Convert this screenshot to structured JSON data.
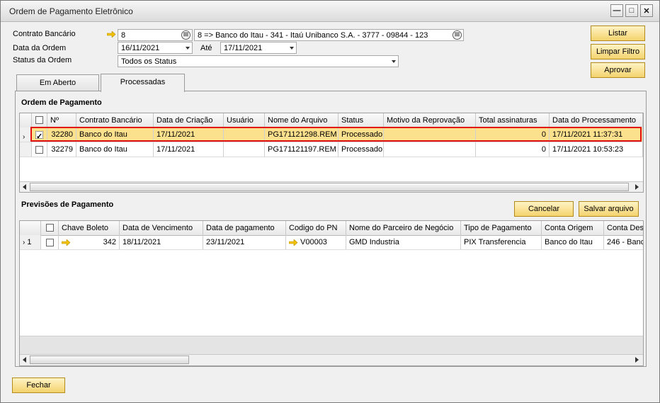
{
  "window": {
    "title": "Ordem de Pagamento Eletrônico",
    "minimize": "—",
    "maximize": "□",
    "close": "✕"
  },
  "filters": {
    "contrato_label": "Contrato Bancário",
    "contrato_value": "8",
    "contrato_desc": "8 => Banco do Itau - 341 - Itaú Unibanco  S.A. - 3777 - 09844 - 123",
    "data_label": "Data da Ordem",
    "data_from": "16/11/2021",
    "ate_label": "Até",
    "data_to": "17/11/2021",
    "status_label": "Status da Ordem",
    "status_value": "Todos os Status"
  },
  "buttons": {
    "listar": "Listar",
    "limpar": "Limpar Filtro",
    "aprovar": "Aprovar",
    "cancelar": "Cancelar",
    "salvar": "Salvar arquivo",
    "fechar": "Fechar"
  },
  "tabs": [
    {
      "label": "Em Aberto"
    },
    {
      "label": "Processadas"
    }
  ],
  "ordem": {
    "title": "Ordem de Pagamento",
    "headers": [
      "Nº",
      "Contrato Bancário",
      "Data de Criação",
      "Usuário",
      "Nome do Arquivo",
      "Status",
      "Motivo da Reprovação",
      "Total assinaturas",
      "Data do Processamento"
    ],
    "rows": [
      {
        "numero": "32280",
        "contrato": "Banco do Itau",
        "criacao": "17/11/2021",
        "usuario": "",
        "arquivo": "PG171121298.REM",
        "status": "Processado",
        "motivo": "",
        "assinaturas": "0",
        "processamento": "17/11/2021 11:37:31",
        "checked": true
      },
      {
        "numero": "32279",
        "contrato": "Banco do Itau",
        "criacao": "17/11/2021",
        "usuario": "",
        "arquivo": "PG171121197.REM",
        "status": "Processado",
        "motivo": "",
        "assinaturas": "0",
        "processamento": "17/11/2021 10:53:23",
        "checked": false
      }
    ]
  },
  "previsoes": {
    "title": "Previsões de Pagamento",
    "headers": [
      "Chave Boleto",
      "Data de Vencimento",
      "Data de pagamento",
      "Codigo do PN",
      "Nome do Parceiro de Negócio",
      "Tipo de Pagamento",
      "Conta Origem",
      "Conta Des"
    ],
    "rows": [
      {
        "index": "1",
        "chave": "342",
        "vencimento": "18/11/2021",
        "pagamento": "23/11/2021",
        "codigo": "V00003",
        "parceiro": "GMD Industria",
        "tipo": "PIX Transferencia",
        "origem": "Banco do Itau",
        "destino": "246 - Banc"
      }
    ]
  },
  "colors": {
    "highlight_row": "#fbe08e",
    "highlight_border": "#e01010",
    "button_fill": "#f4d36e",
    "link_arrow": "#f2c200"
  }
}
